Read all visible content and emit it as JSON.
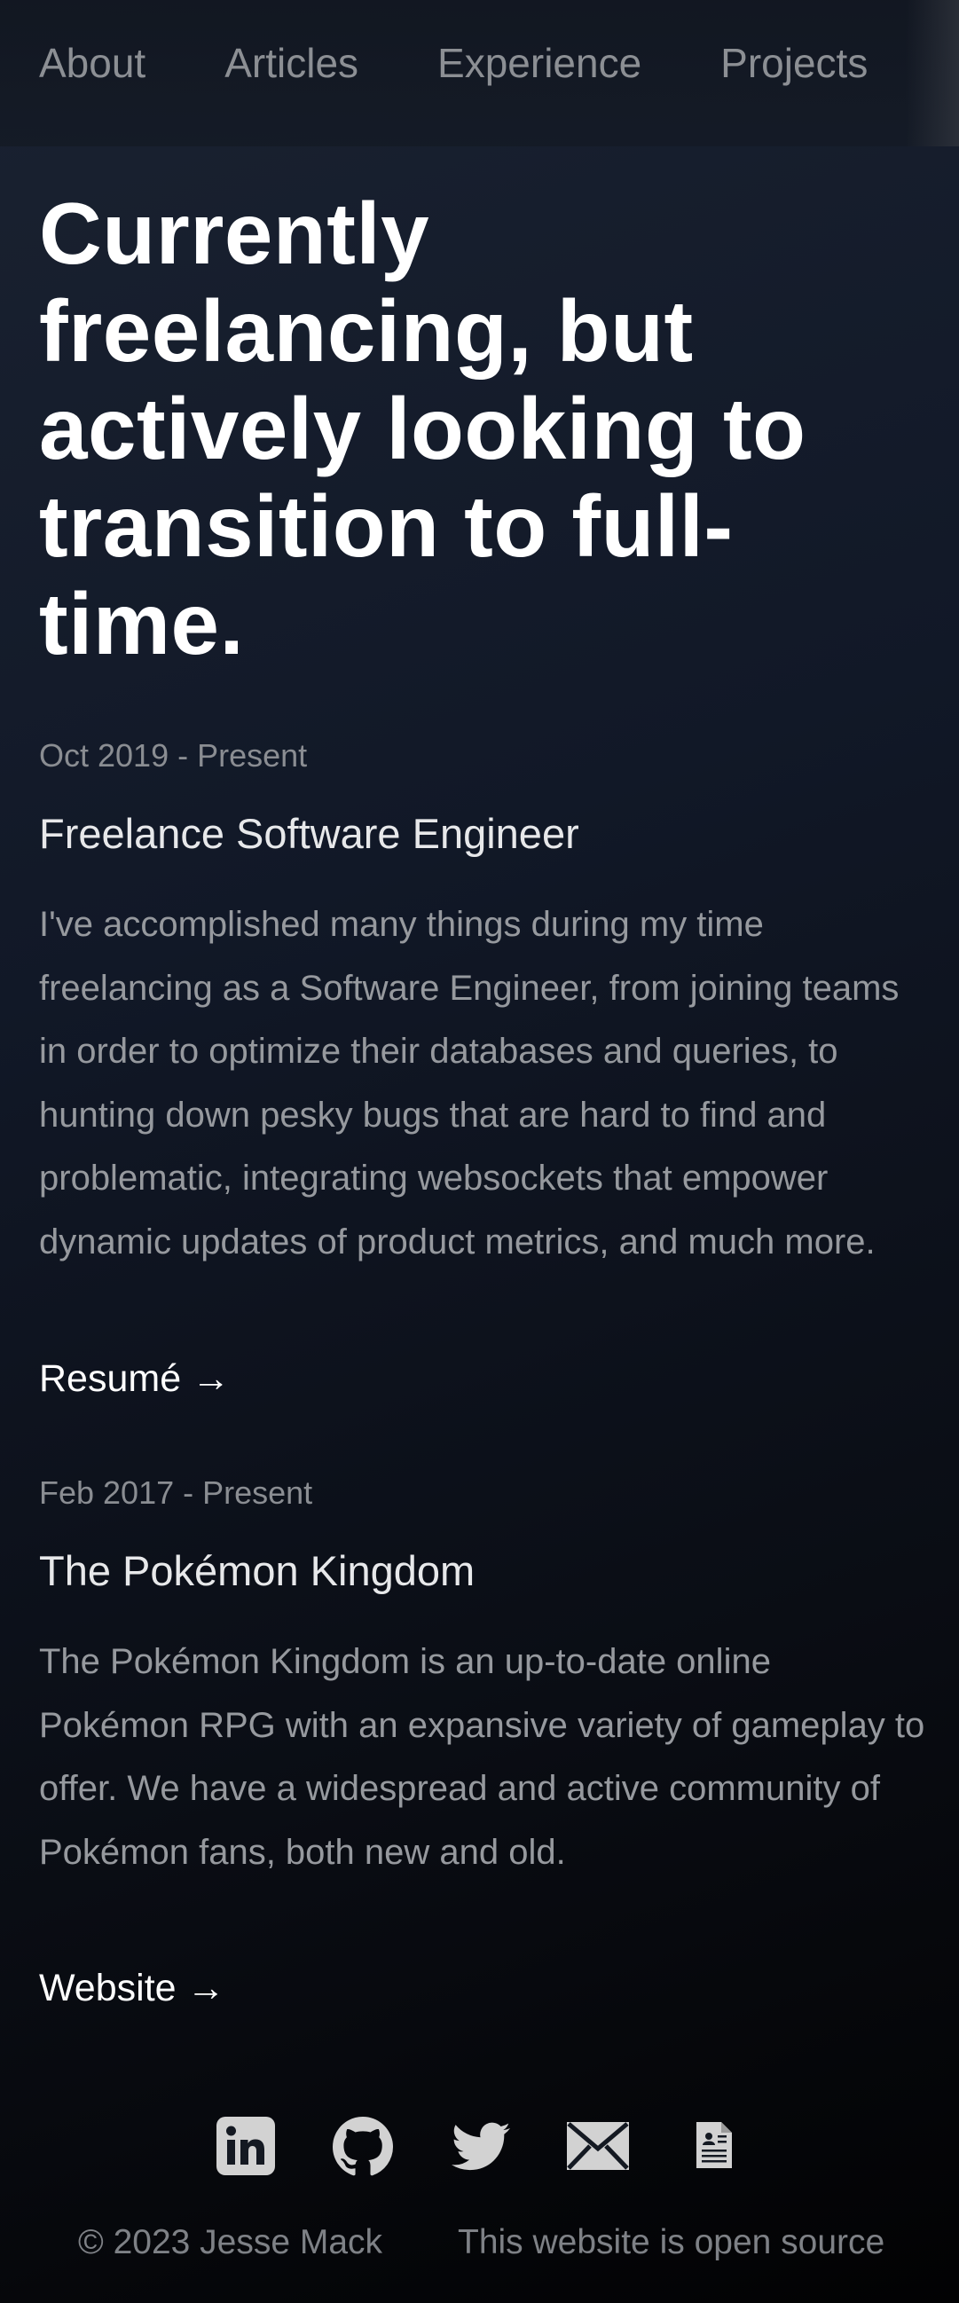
{
  "nav": {
    "items": [
      {
        "label": "About"
      },
      {
        "label": "Articles"
      },
      {
        "label": "Experience"
      },
      {
        "label": "Projects"
      }
    ]
  },
  "hero": {
    "heading": "Currently freelancing, but actively looking to transition to full-time."
  },
  "experience": [
    {
      "date": "Oct 2019 - Present",
      "title": "Freelance Software Engineer",
      "description": "I've accomplished many things during my time freelancing as a Software Engineer, from joining teams in order to optimize their databases and queries, to hunting down pesky bugs that are hard to find and problematic, integrating websockets that empower dynamic updates of product metrics, and much more.",
      "link": "Resumé →"
    },
    {
      "date": "Feb 2017 - Present",
      "title": "The Pokémon Kingdom",
      "description": "The Pokémon Kingdom is an up-to-date online Pokémon RPG with an expansive variety of gameplay to offer. We have a widespread and active community of Pokémon fans, both new and old.",
      "link": "Website →"
    }
  ],
  "footer": {
    "icons": [
      "linkedin-icon",
      "github-icon",
      "twitter-icon",
      "email-icon",
      "resume-icon"
    ],
    "copyright": "© 2023 Jesse Mack",
    "source": "This website is open source"
  },
  "colors": {
    "background": "#111827",
    "heading": "#ffffff",
    "muted": "#8a8d92",
    "icon": "#d1d1d1"
  }
}
